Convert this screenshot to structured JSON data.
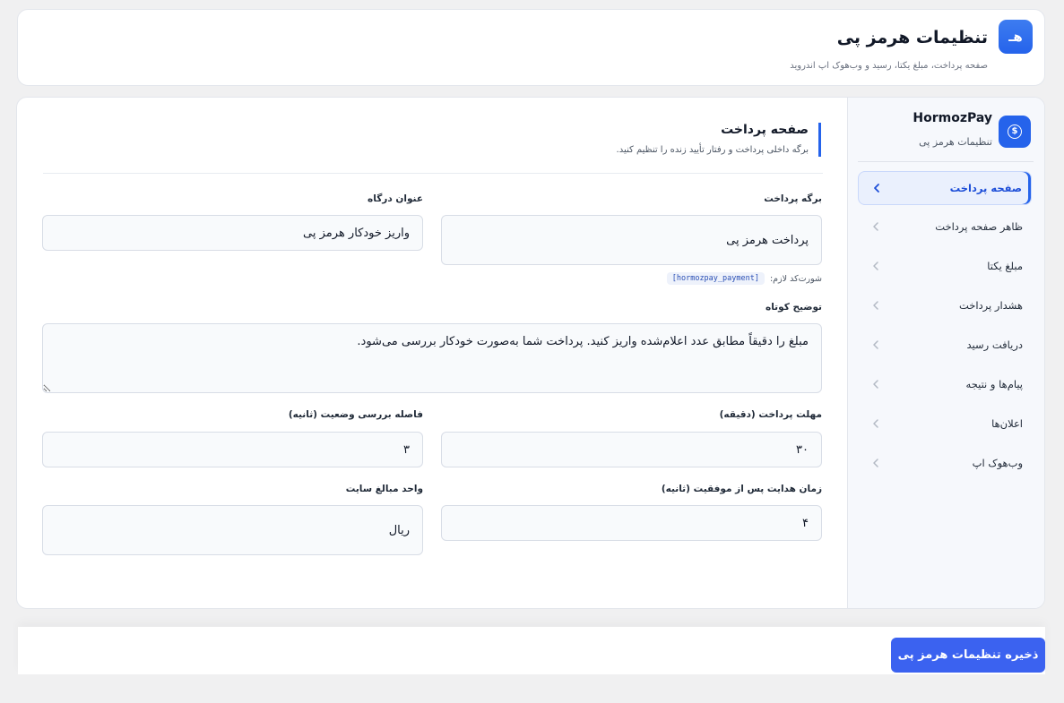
{
  "header": {
    "logo_glyph": "هـ",
    "title": "تنظیمات هرمز پی",
    "subtitle": "صفحه پرداخت، مبلغ یکتا، رسید و وب‌هوک اپ اندروید"
  },
  "sidebar": {
    "brand_name": "HormozPay",
    "brand_subtitle": "تنظیمات هرمز پی",
    "brand_icon": "dollar-circle-icon",
    "items": [
      {
        "label": "صفحه پرداخت",
        "active": true
      },
      {
        "label": "ظاهر صفحه پرداخت",
        "active": false
      },
      {
        "label": "مبلغ یکتا",
        "active": false
      },
      {
        "label": "هشدار پرداخت",
        "active": false
      },
      {
        "label": "دریافت رسید",
        "active": false
      },
      {
        "label": "پیام‌ها و نتیجه",
        "active": false
      },
      {
        "label": "اعلان‌ها",
        "active": false
      },
      {
        "label": "وب‌هوک اپ",
        "active": false
      }
    ]
  },
  "section": {
    "title": "صفحه پرداخت",
    "subtitle": "برگه داخلی پرداخت و رفتار تأیید زنده را تنظیم کنید."
  },
  "form": {
    "payment_page": {
      "label": "برگه پرداخت",
      "value": "پرداخت هرمز پی"
    },
    "gateway_title": {
      "label": "عنوان درگاه",
      "value": "واریز خودکار هرمز پی"
    },
    "shortcode": {
      "label": "شورت‌کد لازم:",
      "value": "[hormozpay_payment]"
    },
    "short_description": {
      "label": "توضیح کوتاه",
      "value": "مبلغ را دقیقاً مطابق عدد اعلام‌شده واریز کنید. پرداخت شما به‌صورت خودکار بررسی می‌شود."
    },
    "payment_deadline": {
      "label": "مهلت پرداخت (دقیقه)",
      "value": "۳۰"
    },
    "check_interval": {
      "label": "فاصله بررسی وضعیت (ثانیه)",
      "value": "۳"
    },
    "redirect_time": {
      "label": "زمان هدایت پس از موفقیت (ثانیه)",
      "value": "۴"
    },
    "currency_unit": {
      "label": "واحد مبالغ سایت",
      "value": "ریال"
    }
  },
  "footer": {
    "save_label": "ذخیره تنظیمات هرمز پی"
  },
  "colors": {
    "accent": "#2563eb",
    "button": "#3b62f0"
  }
}
